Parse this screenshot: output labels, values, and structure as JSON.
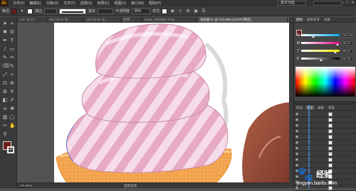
{
  "app": {
    "logo": "Ai"
  },
  "menu": [
    "文件(F)",
    "编辑(E)",
    "对象(O)",
    "文字(T)",
    "选择(S)",
    "效果(C)",
    "视图(V)",
    "窗口(W)",
    "帮助(H)"
  ],
  "workspace": "基本功能",
  "window_buttons": [
    "–",
    "□",
    "✕"
  ],
  "controlbar": {
    "path_label": "路径",
    "fill_color": "#6d1a1a",
    "stroke_label": "描边",
    "stroke_value": "",
    "basic_label": "基本",
    "opacity_label": "不透明度",
    "opacity_value": "39%",
    "style_label": "样式"
  },
  "tabs": [
    {
      "label": "1.ai* @ 27...",
      "active": false
    },
    {
      "label": "081 (2).ai* @ ...",
      "active": false
    },
    {
      "label": "129 (3).ai* @ ...",
      "active": false
    },
    {
      "label": "新建...",
      "active": false
    },
    {
      "label": "Nepa_4050997 2010...",
      "active": false
    },
    {
      "label": "未标题-1* @ 276.68% (CMYK/预览)",
      "active": true
    }
  ],
  "tools": [
    "selection-icon",
    "direct-selection-icon",
    "magic-wand-icon",
    "lasso-icon",
    "pen-icon",
    "type-icon",
    "line-icon",
    "rectangle-icon",
    "brush-icon",
    "pencil-icon",
    "eraser-icon",
    "rotate-icon",
    "scale-icon",
    "width-icon",
    "free-transform-icon",
    "shape-builder-icon",
    "perspective-icon",
    "mesh-icon",
    "gradient-icon",
    "eyedropper-icon",
    "blend-icon",
    "symbol-sprayer-icon",
    "graph-icon",
    "artboard-icon",
    "slice-icon",
    "hand-icon",
    "zoom-icon"
  ],
  "tool_glyphs": [
    "➤",
    "➢",
    "✱",
    "ʘ",
    "✒",
    "T",
    "/",
    "▭",
    "✎",
    "✏",
    "⌫",
    "↻",
    "⤢",
    "≈",
    "⊡",
    "⊕",
    "⊞",
    "#",
    "◧",
    "✐",
    "∞",
    "❋",
    "▥",
    "▢",
    "✂",
    "✋",
    "⚲"
  ],
  "colors": {
    "fill": "#6d1a1a",
    "accent": "#ff9a00"
  },
  "status": {
    "zoom": "276.68%",
    "tool_name": "直接选择"
  },
  "color_panel": {
    "tabs": [
      "颜色",
      "颜色参考",
      "色板"
    ],
    "sliders": [
      {
        "letter": "C",
        "value": "31.4 %",
        "pos": 0.31
      },
      {
        "letter": "M",
        "value": "93.73",
        "pos": 0.94
      },
      {
        "letter": "Y",
        "value": "89.41",
        "pos": 0.89
      },
      {
        "letter": "K",
        "value": "51.76",
        "pos": 0.52
      }
    ]
  },
  "layers_panel": {
    "tabs": [
      "描边",
      "图层",
      "画板",
      "渐变",
      "透明度",
      "外观"
    ],
    "rows": 14
  },
  "watermark": {
    "paw": "🐾",
    "title": "经验",
    "url": "jingyan.baidu.com"
  }
}
